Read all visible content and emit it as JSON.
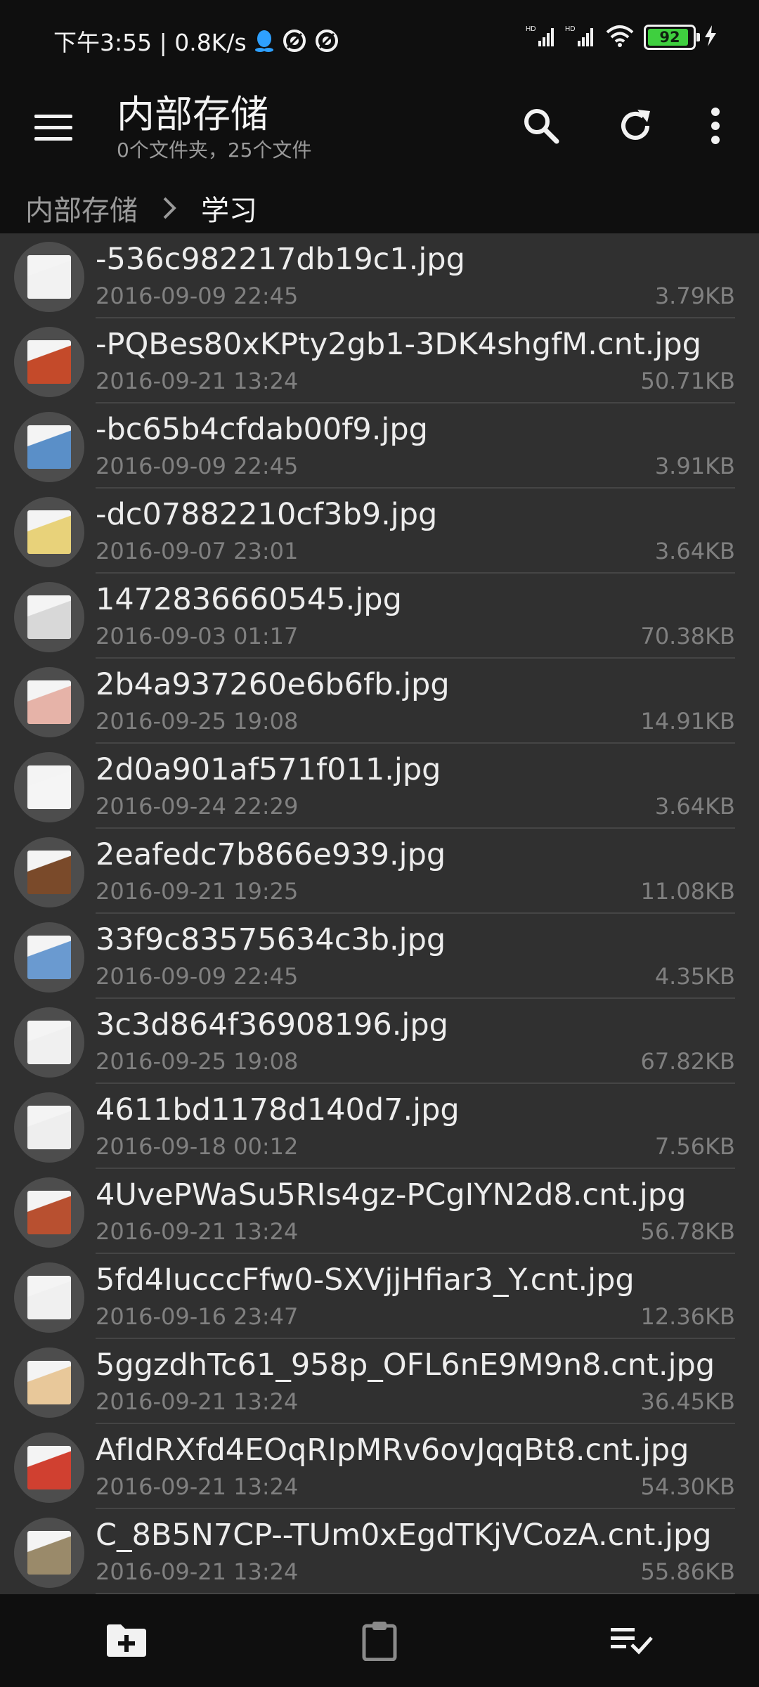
{
  "status_bar": {
    "time": "下午3:55 | 0.8K/s",
    "battery_level": "92",
    "battery_color": "#3fcf3f",
    "network_label": "HD"
  },
  "app_bar": {
    "title": "内部存储",
    "subtitle": "0个文件夹，25个文件",
    "icons": [
      "menu-icon",
      "search-icon",
      "refresh-icon",
      "more-vertical-icon"
    ]
  },
  "breadcrumb": {
    "root": "内部存储",
    "current": "学习"
  },
  "files": [
    {
      "name": "-536c982217db19c1.jpg",
      "date": "2016-09-09 22:45",
      "size": "3.79KB",
      "thumb_color": "#f2f2f2"
    },
    {
      "name": "-PQBes80xKPty2gb1-3DK4shgfM.cnt.jpg",
      "date": "2016-09-21 13:24",
      "size": "50.71KB",
      "thumb_color": "#c44a2a"
    },
    {
      "name": "-bc65b4cfdab00f9.jpg",
      "date": "2016-09-09 22:45",
      "size": "3.91KB",
      "thumb_color": "#5a8fc8"
    },
    {
      "name": "-dc07882210cf3b9.jpg",
      "date": "2016-09-07 23:01",
      "size": "3.64KB",
      "thumb_color": "#e8d27a"
    },
    {
      "name": "1472836660545.jpg",
      "date": "2016-09-03 01:17",
      "size": "70.38KB",
      "thumb_color": "#d8d8d8"
    },
    {
      "name": "2b4a937260e6b6fb.jpg",
      "date": "2016-09-25 19:08",
      "size": "14.91KB",
      "thumb_color": "#e6b3a8"
    },
    {
      "name": "2d0a901af571f011.jpg",
      "date": "2016-09-24 22:29",
      "size": "3.64KB",
      "thumb_color": "#f5f5f5"
    },
    {
      "name": "2eafedc7b866e939.jpg",
      "date": "2016-09-21 19:25",
      "size": "11.08KB",
      "thumb_color": "#7a4a2a"
    },
    {
      "name": "33f9c83575634c3b.jpg",
      "date": "2016-09-09 22:45",
      "size": "4.35KB",
      "thumb_color": "#6a9ad0"
    },
    {
      "name": "3c3d864f36908196.jpg",
      "date": "2016-09-25 19:08",
      "size": "67.82KB",
      "thumb_color": "#f0f0f0"
    },
    {
      "name": "4611bd1178d140d7.jpg",
      "date": "2016-09-18 00:12",
      "size": "7.56KB",
      "thumb_color": "#eeeeee"
    },
    {
      "name": "4UvePWaSu5RIs4gz-PCgIYN2d8.cnt.jpg",
      "date": "2016-09-21 13:24",
      "size": "56.78KB",
      "thumb_color": "#b85030"
    },
    {
      "name": "5fd4IucccFfw0-SXVjjHfiar3_Y.cnt.jpg",
      "date": "2016-09-16 23:47",
      "size": "12.36KB",
      "thumb_color": "#f0f0f0"
    },
    {
      "name": "5ggzdhTc61_958p_OFL6nE9M9n8.cnt.jpg",
      "date": "2016-09-21 13:24",
      "size": "36.45KB",
      "thumb_color": "#e8c89a"
    },
    {
      "name": "AfIdRXfd4EOqRIpMRv6ovJqqBt8.cnt.jpg",
      "date": "2016-09-21 13:24",
      "size": "54.30KB",
      "thumb_color": "#d04030"
    },
    {
      "name": "C_8B5N7CP--TUm0xEgdTKjVCozA.cnt.jpg",
      "date": "2016-09-21 13:24",
      "size": "55.86KB",
      "thumb_color": "#9a8a6a"
    }
  ],
  "bottom_bar": {
    "icons": [
      "new-folder-icon",
      "clipboard-icon",
      "select-all-icon"
    ]
  }
}
